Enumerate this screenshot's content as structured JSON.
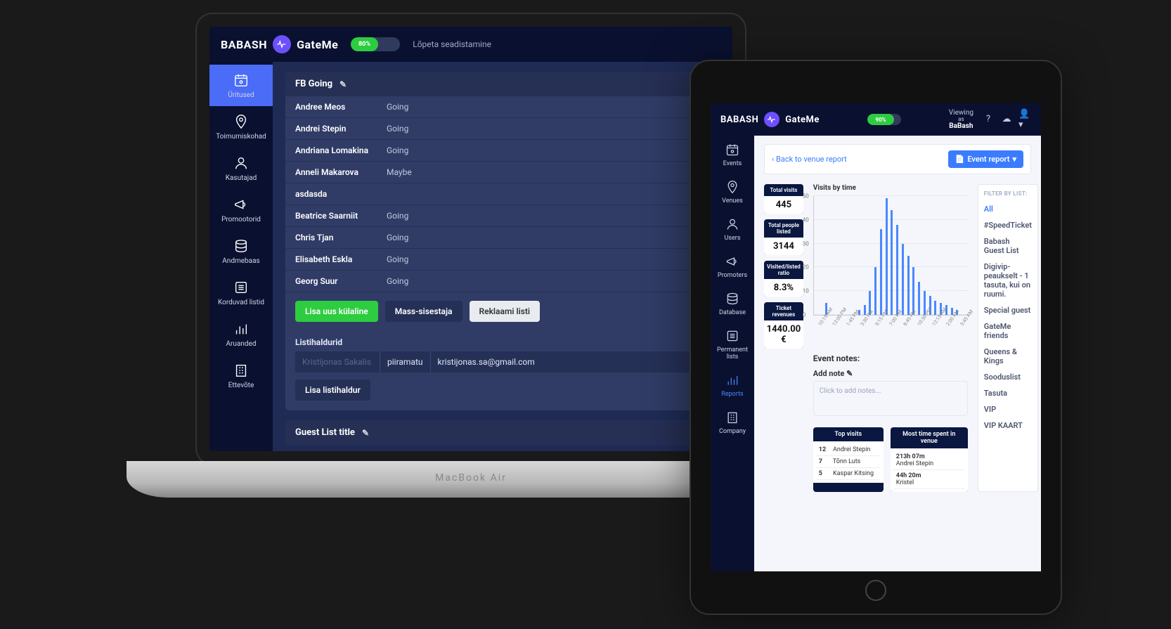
{
  "laptop": {
    "device_label": "MacBook Air",
    "header": {
      "brand1": "BABASH",
      "brand2": "GateMe",
      "progress": "80%",
      "link": "Lõpeta seadistamine"
    },
    "sidebar": [
      {
        "label": "Üritused",
        "icon": "calendar"
      },
      {
        "label": "Toimumiskohad",
        "icon": "pin"
      },
      {
        "label": "Kasutajad",
        "icon": "user"
      },
      {
        "label": "Promootorid",
        "icon": "megaphone"
      },
      {
        "label": "Andmebaas",
        "icon": "database"
      },
      {
        "label": "Korduvad listid",
        "icon": "list"
      },
      {
        "label": "Aruanded",
        "icon": "bars"
      },
      {
        "label": "Ettevõte",
        "icon": "building"
      }
    ],
    "panel1_title": "FB Going",
    "guests": [
      {
        "name": "Andree Meos",
        "status": "Going"
      },
      {
        "name": "Andrei Stepin",
        "status": "Going"
      },
      {
        "name": "Andriana Lomakina",
        "status": "Going"
      },
      {
        "name": "Anneli Makarova",
        "status": "Maybe"
      },
      {
        "name": "asdasda",
        "status": ""
      },
      {
        "name": "Beatrice Saarniit",
        "status": "Going"
      },
      {
        "name": "Chris Tjan",
        "status": "Going"
      },
      {
        "name": "Elisabeth Eskla",
        "status": "Going"
      },
      {
        "name": "Georg Suur",
        "status": "Going"
      }
    ],
    "buttons": {
      "add_guest": "Lisa uus külaline",
      "bulk": "Mass-sisestaja",
      "promote": "Reklaami listi"
    },
    "managers_label": "Listihaldurid",
    "manager_placeholder": "Kristijonas Sakalis",
    "manager_badge": "piiramatu",
    "manager_email": "kristijonas.sa@gmail.com",
    "add_manager_btn": "Lisa listihaldur",
    "panel2_title": "Guest List title"
  },
  "tablet": {
    "header": {
      "brand1": "BABASH",
      "brand2": "GateMe",
      "progress": "90%",
      "viewing_label": "Viewing",
      "viewing_as": "as",
      "viewing_name": "BaBash"
    },
    "sidebar": [
      {
        "label": "Events",
        "icon": "calendar"
      },
      {
        "label": "Venues",
        "icon": "pin"
      },
      {
        "label": "Users",
        "icon": "user"
      },
      {
        "label": "Promoters",
        "icon": "megaphone"
      },
      {
        "label": "Database",
        "icon": "database"
      },
      {
        "label": "Permanent lists",
        "icon": "list"
      },
      {
        "label": "Reports",
        "icon": "bars"
      },
      {
        "label": "Company",
        "icon": "building"
      }
    ],
    "back_link": "‹ Back to venue report",
    "report_btn": "Event report",
    "stats": [
      {
        "label": "Total visits",
        "value": "445"
      },
      {
        "label": "Total people listed",
        "value": "3144"
      },
      {
        "label": "Visited/listed ratio",
        "value": "8.3%"
      },
      {
        "label": "Ticket revenues",
        "value": "1440.00 €"
      }
    ],
    "filter_head": "FILTER BY LIST:",
    "filters": [
      "All",
      "#SpeedTicket",
      "Babash Guest List",
      "Digivip-peaukselt - 1 tasuta, kui on ruumi.",
      "Special guest",
      "GateMe friends",
      "Queens & Kings",
      "Sooduslist",
      "Tasuta",
      "VIP",
      "VIP KAART"
    ],
    "notes_head": "Event notes:",
    "add_note": "Add note",
    "note_placeholder": "Click to add notes...",
    "top_visits_head": "Top visits",
    "top_visits": [
      {
        "n": "12",
        "name": "Andrei Stepin"
      },
      {
        "n": "7",
        "name": "Tõnn Luts"
      },
      {
        "n": "5",
        "name": "Kaspar Kitsing"
      }
    ],
    "most_time_head": "Most time spent in venue",
    "most_time": [
      {
        "t": "213h 07m",
        "name": "Andrei Stepin"
      },
      {
        "t": "44h 20m",
        "name": "Kristel"
      }
    ]
  },
  "chart_data": {
    "type": "bar",
    "title": "Visits by time",
    "ylabel": "",
    "ylim": [
      0,
      50
    ],
    "yticks": [
      0,
      10,
      20,
      30,
      40,
      50
    ],
    "categories": [
      "10:15 AM",
      "12:00 PM",
      "1:45 PM",
      "3:30 PM",
      "5:15 PM",
      "7:00 PM",
      "8:45 PM",
      "10:30 PM",
      "12:15 AM",
      "2:00 AM",
      "3:45 AM"
    ],
    "values": [
      0,
      5,
      0,
      0,
      0,
      0,
      0,
      2,
      4,
      10,
      20,
      36,
      49,
      44,
      38,
      30,
      25,
      20,
      14,
      10,
      8,
      6,
      5,
      4,
      3,
      2
    ]
  }
}
